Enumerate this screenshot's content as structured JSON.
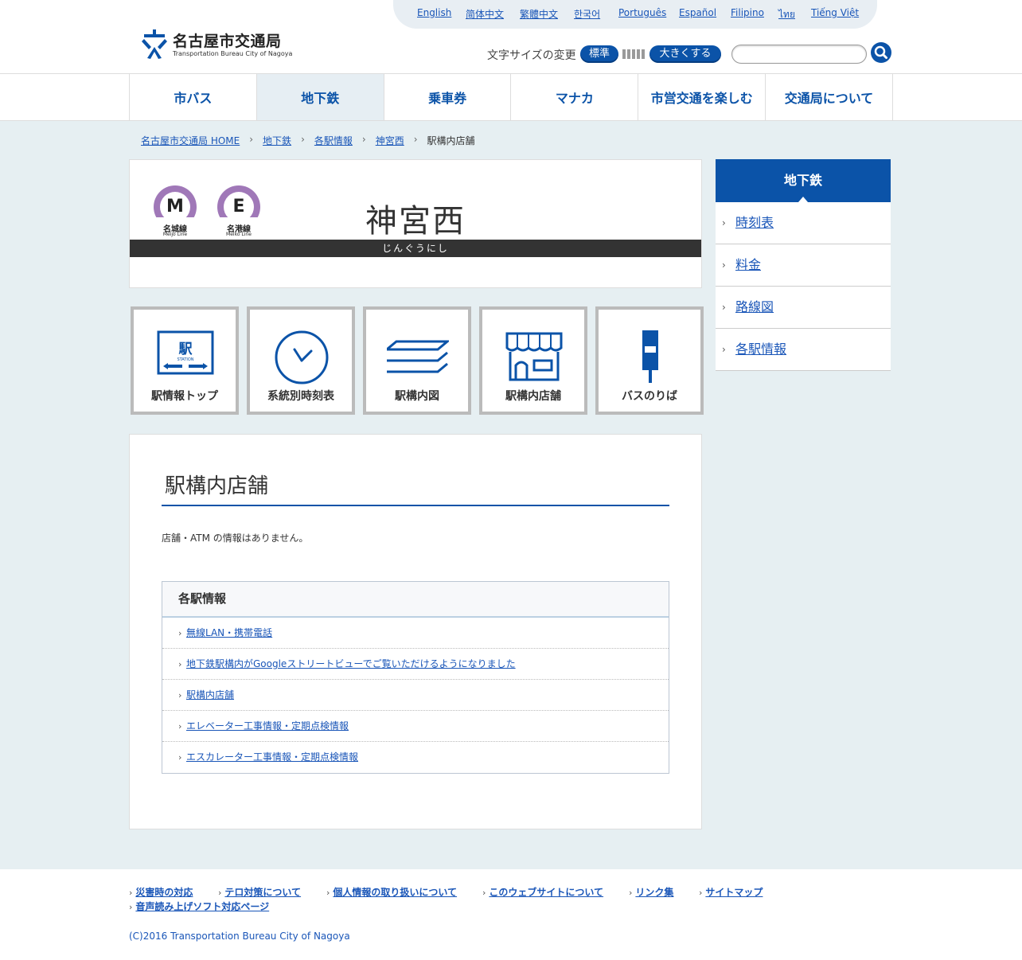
{
  "languages": [
    "English",
    "简体中文",
    "繁體中文",
    "한국어",
    "Português",
    "Español",
    "Filipino",
    "ไทย",
    "Tiếng Việt"
  ],
  "header": {
    "logo_title": "名古屋市交通局",
    "logo_subtitle": "Transportation Bureau City of Nagoya",
    "font_size_label": "文字サイズの変更",
    "font_standard": "標準",
    "font_larger": "大きくする",
    "search_placeholder": ""
  },
  "gnav": [
    "市バス",
    "地下鉄",
    "乗車券",
    "マナカ",
    "市営交通を楽しむ",
    "交通局について"
  ],
  "gnav_active": "地下鉄",
  "breadcrumb": [
    "名古屋市交通局 HOME",
    "地下鉄",
    "各駅情報",
    "神宮西",
    "駅構内店舗"
  ],
  "station": {
    "name": "神宮西",
    "kana": "じんぐうにし",
    "lines": [
      {
        "letter": "M",
        "jp": "名城線",
        "en": "Meijo Line",
        "color": "#a078b8"
      },
      {
        "letter": "E",
        "jp": "名港線",
        "en": "Meiko Line",
        "color": "#a078b8"
      }
    ]
  },
  "tiles": [
    "駅情報トップ",
    "系統別時刻表",
    "駅構内図",
    "駅構内店舗",
    "バスのりば"
  ],
  "content": {
    "title": "駅構内店舗",
    "message": "店舗・ATM の情報はありません。",
    "sublist_title": "各駅情報",
    "sublist_items": [
      "無線LAN・携帯電話",
      "地下鉄駅構内がGoogleストリートビューでご覧いただけるようになりました",
      "駅構内店舗",
      "エレベーター工事情報・定期点検情報",
      "エスカレーター工事情報・定期点検情報"
    ]
  },
  "sidebar": {
    "title": "地下鉄",
    "items": [
      "時刻表",
      "料金",
      "路線図",
      "各駅情報"
    ]
  },
  "footer": {
    "links": [
      "災害時の対応",
      "テロ対策について",
      "個人情報の取り扱いについて",
      "このウェブサイトについて",
      "リンク集",
      "サイトマップ",
      "音声読み上げソフト対応ページ"
    ],
    "copyright": "(C)2016 Transportation Bureau City of Nagoya"
  },
  "colors": {
    "brand_blue": "#0b53a8",
    "page_bg": "#e6eff2",
    "line_purple": "#a078b8"
  }
}
